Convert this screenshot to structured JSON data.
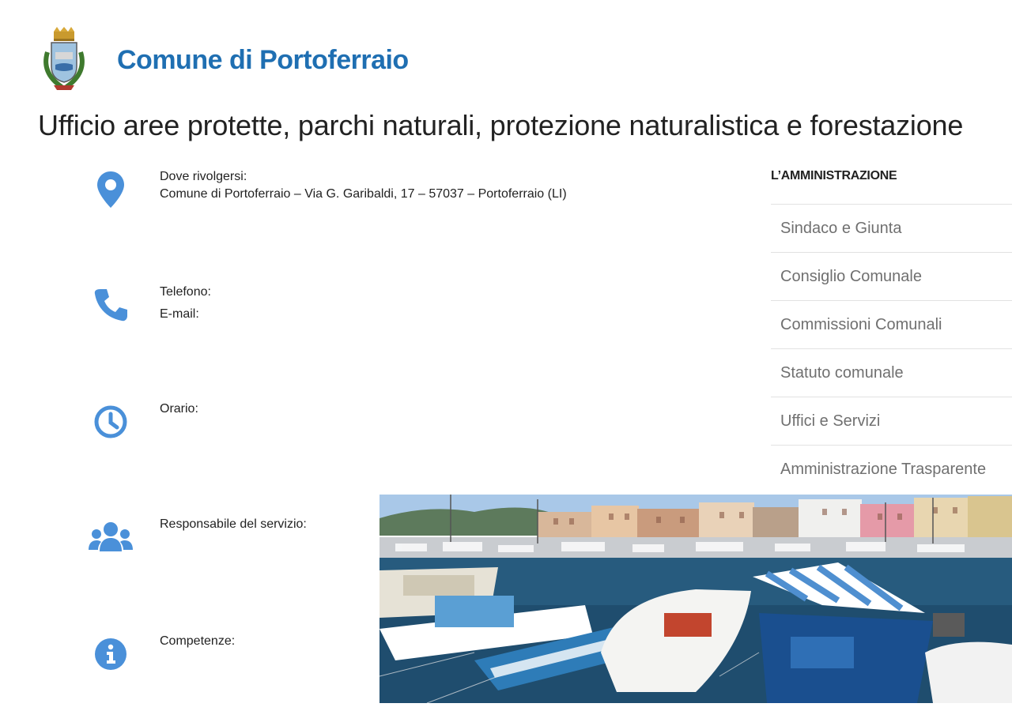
{
  "site": {
    "name": "Comune di Portoferraio",
    "logo_icon": "municipal-crest-icon",
    "accent_color": "#1f6fb2",
    "icon_color": "#4a90d9"
  },
  "page": {
    "title": "Ufficio aree protette, parchi naturali, protezione naturalistica e forestazione"
  },
  "info": {
    "location": {
      "icon": "map-marker-icon",
      "label": "Dove rivolgersi:",
      "value": "Comune di Portoferraio – Via G. Garibaldi, 17 – 57037 – Portoferraio (LI)"
    },
    "contacts": {
      "icon": "phone-icon",
      "phone_label": "Telefono:",
      "email_label": "E-mail:"
    },
    "hours": {
      "icon": "clock-icon",
      "label": "Orario:"
    },
    "manager": {
      "icon": "users-icon",
      "label": "Responsabile del servizio:"
    },
    "competences": {
      "icon": "info-icon",
      "label": "Competenze:"
    }
  },
  "sidebar": {
    "heading": "L’AMMINISTRAZIONE",
    "items": [
      {
        "label": "Sindaco e Giunta"
      },
      {
        "label": "Consiglio Comunale"
      },
      {
        "label": "Commissioni Comunali"
      },
      {
        "label": "Statuto comunale"
      },
      {
        "label": "Uffici e Servizi"
      },
      {
        "label": "Amministrazione Trasparente"
      }
    ]
  },
  "photo": {
    "subject": "harbor-boats-photo"
  }
}
